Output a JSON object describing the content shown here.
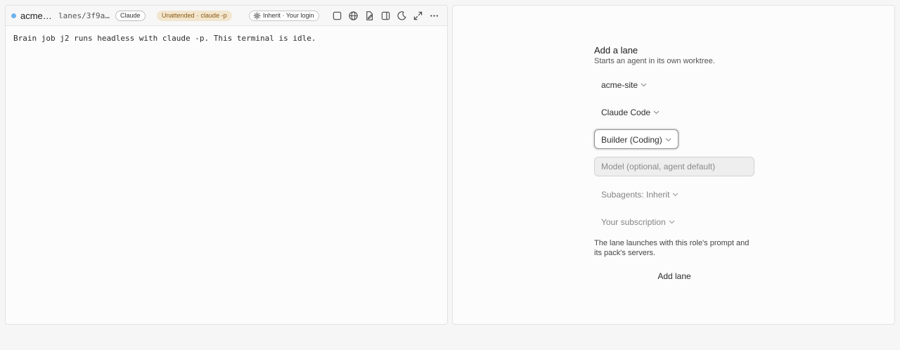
{
  "terminal_pane": {
    "title": "acme…",
    "path": "lanes/3f9a…",
    "agent_badge": "Claude",
    "mode_badge": "Unattended",
    "mode_flag": "claude -p",
    "login_badge": "Inherit · Your login",
    "terminal_text": "Brain job j2 runs headless with claude -p. This terminal is idle.",
    "status_dot_color": "#6fb2ee",
    "icons": [
      "square-icon",
      "globe-icon",
      "edit-file-icon",
      "split-panel-icon",
      "moon-icon",
      "expand-icon",
      "more-icon"
    ]
  },
  "add_lane_form": {
    "title": "Add a lane",
    "subtitle": "Starts an agent in its own worktree.",
    "project": "acme-site",
    "agent": "Claude Code",
    "role": "Builder (Coding)",
    "model_placeholder": "Model (optional, agent default)",
    "model_value": "",
    "subagents": "Subagents: Inherit",
    "billing": "Your subscription",
    "note": "The lane launches with this role's prompt and its pack's servers.",
    "submit_label": "Add lane"
  }
}
